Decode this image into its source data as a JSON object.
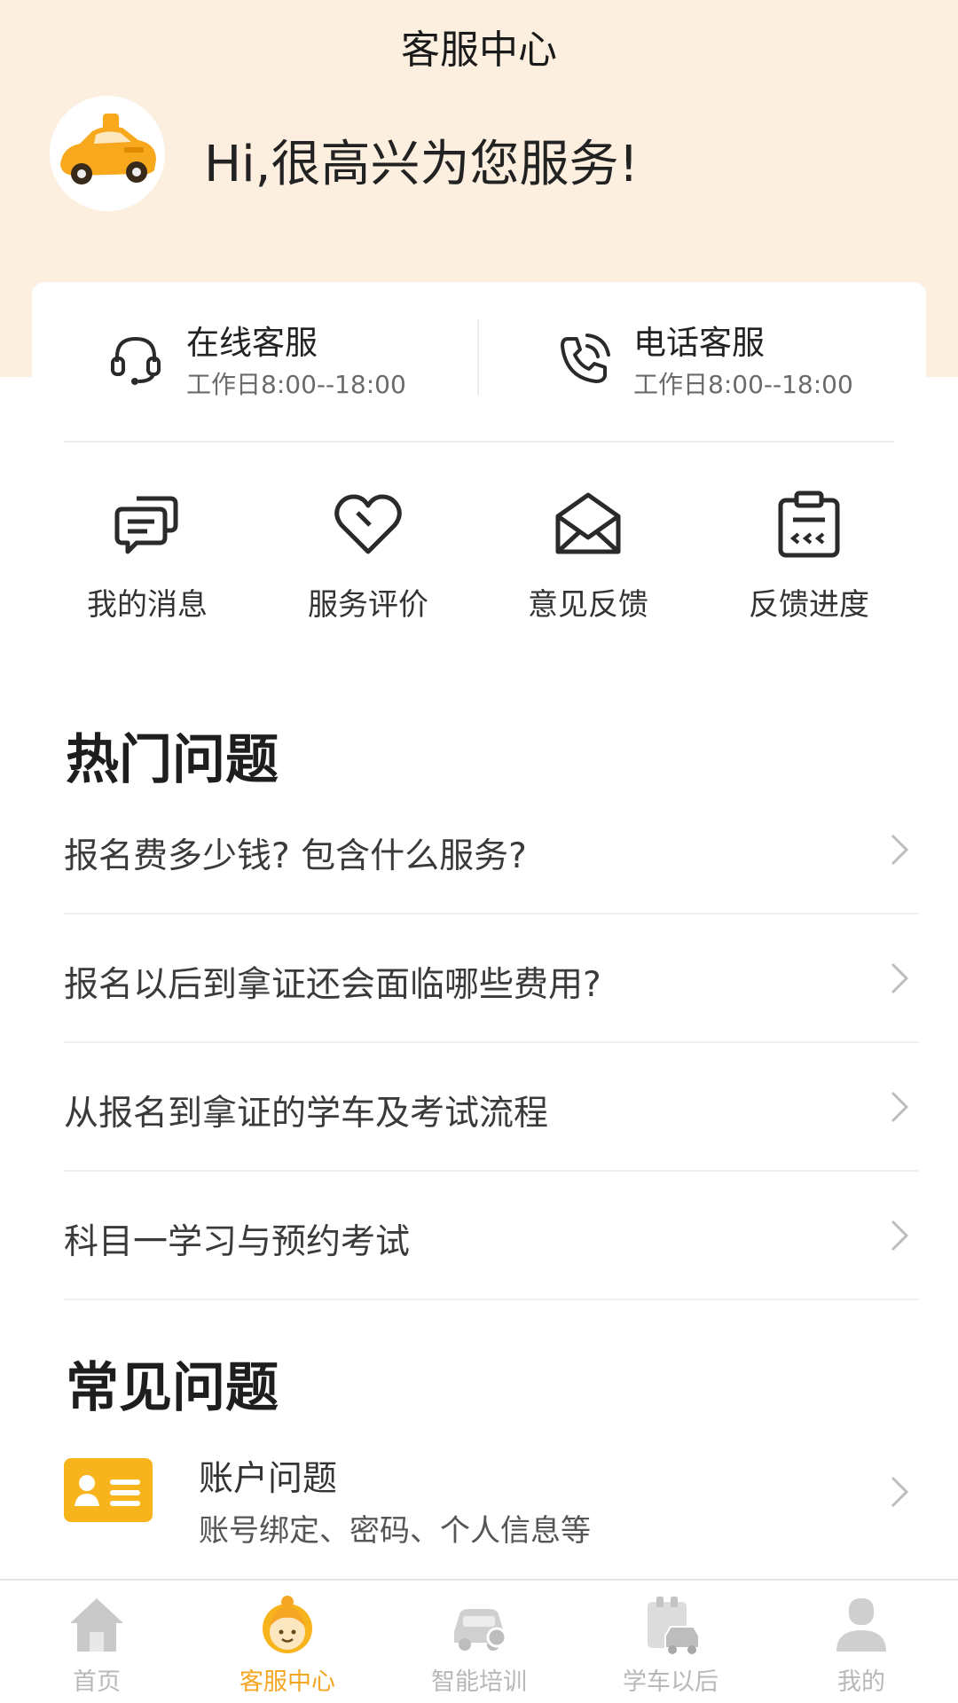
{
  "header": {
    "title": "客服中心",
    "greeting": "Hi,很高兴为您服务!"
  },
  "contacts": [
    {
      "title": "在线客服",
      "hours": "工作日8:00--18:00",
      "icon": "headset-icon"
    },
    {
      "title": "电话客服",
      "hours": "工作日8:00--18:00",
      "icon": "phone-icon"
    }
  ],
  "tools": [
    {
      "label": "我的消息",
      "icon": "message-icon"
    },
    {
      "label": "服务评价",
      "icon": "heart-icon"
    },
    {
      "label": "意见反馈",
      "icon": "envelope-icon"
    },
    {
      "label": "反馈进度",
      "icon": "clipboard-icon"
    }
  ],
  "hot_questions": {
    "title": "热门问题",
    "items": [
      "报名费多少钱? 包含什么服务?",
      "报名以后到拿证还会面临哪些费用?",
      "从报名到拿证的学车及考试流程",
      "科目一学习与预约考试"
    ]
  },
  "common_questions": {
    "title": "常见问题",
    "items": [
      {
        "title": "账户问题",
        "subtitle": "账号绑定、密码、个人信息等",
        "icon": "id-card-icon"
      }
    ]
  },
  "tabbar": {
    "items": [
      {
        "label": "首页",
        "icon": "home-icon",
        "active": false
      },
      {
        "label": "客服中心",
        "icon": "service-agent-icon",
        "active": true
      },
      {
        "label": "智能培训",
        "icon": "car-training-icon",
        "active": false
      },
      {
        "label": "学车以后",
        "icon": "after-learning-icon",
        "active": false
      },
      {
        "label": "我的",
        "icon": "user-icon",
        "active": false
      }
    ]
  },
  "colors": {
    "header_bg": "#fcefdf",
    "accent": "#f5a623",
    "tab_inactive": "#b8b8b8"
  }
}
